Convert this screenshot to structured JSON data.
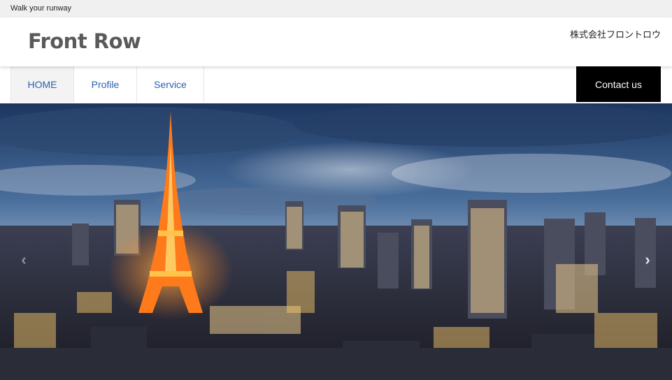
{
  "topbar": {
    "tagline": "Walk your runway"
  },
  "header": {
    "logo": "Front Row",
    "company": "株式会社フロントロウ"
  },
  "nav": {
    "items": [
      {
        "label": "HOME",
        "active": true
      },
      {
        "label": "Profile",
        "active": false
      },
      {
        "label": "Service",
        "active": false
      }
    ],
    "contact_label": "Contact us"
  },
  "hero": {
    "image": "tokyo-tower-city-night-skyline",
    "prev_icon": "chevron-left-icon",
    "next_icon": "chevron-right-icon",
    "prev_glyph": "‹",
    "next_glyph": "›"
  },
  "colors": {
    "nav_link": "#2a62b0",
    "contact_bg": "#000000",
    "topbar_bg": "#f0f0f0",
    "logo": "#5a5a5a",
    "tower": "#ff7a1a"
  }
}
